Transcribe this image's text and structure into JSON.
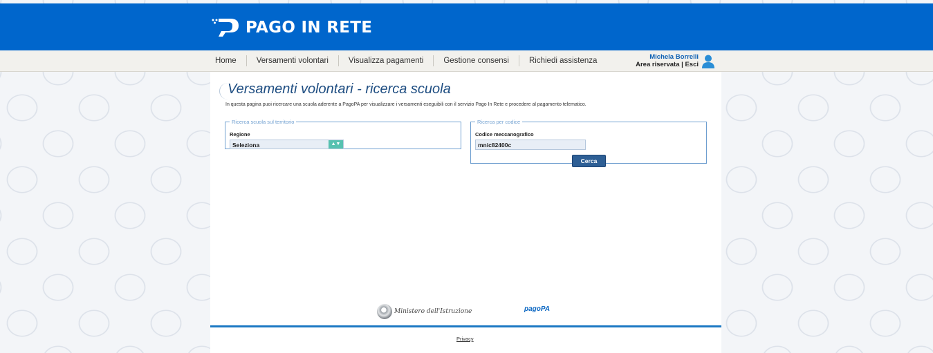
{
  "header": {
    "title": "PAGO IN RETE",
    "brand_color": "#0066cc"
  },
  "nav": {
    "items": [
      {
        "label": "Home"
      },
      {
        "label": "Versamenti volontari"
      },
      {
        "label": "Visualizza pagamenti"
      },
      {
        "label": "Gestione consensi"
      },
      {
        "label": "Richiedi assistenza"
      }
    ]
  },
  "user": {
    "name": "Michela Borrelli",
    "area": "Area riservata",
    "separator": "|",
    "logout": "Esci",
    "icon": "user-icon"
  },
  "page": {
    "title": "Versamenti volontari - ricerca scuola",
    "intro": "In questa pagina puoi ricercare una scuola aderente a PagoPA per visualizzare i versamenti eseguibili con il servizio Pago In Rete e procedere al pagamento telematico."
  },
  "search_territory": {
    "legend": "Ricerca scuola sul territorio",
    "region_label": "Regione",
    "region_value": "Seleziona"
  },
  "search_code": {
    "legend": "Ricerca per codice",
    "code_label": "Codice meccanografico",
    "code_value": "mnic82400c",
    "button_label": "Cerca"
  },
  "footer": {
    "ministry_text": "Ministero dell'Istruzione",
    "pagopa_text": "pagoPA",
    "privacy_label": "Privacy"
  }
}
